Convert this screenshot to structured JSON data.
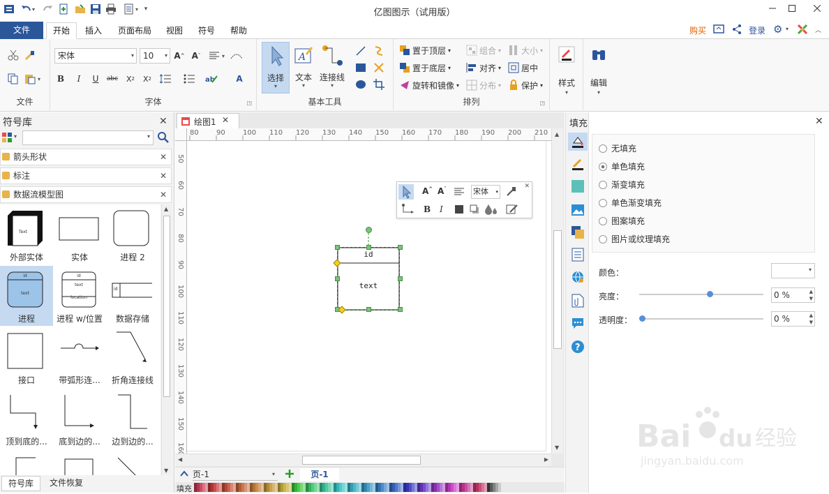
{
  "app": {
    "title": "亿图图示（试用版）"
  },
  "ribbon": {
    "file_tab": "文件",
    "tabs": [
      "开始",
      "插入",
      "页面布局",
      "视图",
      "符号",
      "帮助"
    ],
    "right": {
      "buy": "购买",
      "login": "登录"
    },
    "groups": {
      "file": "文件",
      "font": "字体",
      "basic_tools": "基本工具",
      "arrange": "排列",
      "style": "样式",
      "edit": "编辑"
    },
    "font": {
      "family": "宋体",
      "size": "10"
    },
    "tools": {
      "select": "选择",
      "text": "文本",
      "connector": "连接线"
    },
    "arrange": {
      "bring_front": "置于顶层",
      "send_back": "置于底层",
      "rotate_mirror": "旋转和镜像",
      "group": "组合",
      "align": "对齐",
      "distribute": "分布",
      "size": "大小",
      "center": "居中",
      "protect": "保护"
    }
  },
  "library": {
    "title": "符号库",
    "search_placeholder": "",
    "categories": [
      "箭头形状",
      "标注",
      "数据流模型图"
    ],
    "symbols": [
      "外部实体",
      "实体",
      "进程 2",
      "进程",
      "进程 w/位置",
      "数据存储",
      "接口",
      "带弧形连...",
      "折角连接线",
      "顶到底的...",
      "底到边的...",
      "边到边的..."
    ],
    "symbol_texts": {
      "ext_text": "Text",
      "id": "id",
      "text": "text",
      "location": "location"
    },
    "bottom_tabs": [
      "符号库",
      "文件恢复"
    ]
  },
  "document": {
    "tab": "绘图1",
    "page_select": "页-1",
    "page_tab": "页-1",
    "fill_label": "填充"
  },
  "ruler": {
    "h": [
      "80",
      "90",
      "100",
      "110",
      "120",
      "130",
      "140",
      "150",
      "160",
      "170",
      "180",
      "190",
      "200",
      "210"
    ],
    "v": [
      "50",
      "60",
      "70",
      "80",
      "90",
      "100",
      "110",
      "120",
      "130",
      "140",
      "150",
      "160"
    ]
  },
  "shape": {
    "id_text": "id",
    "body_text": "text"
  },
  "mini_toolbar": {
    "font": "宋体"
  },
  "fill_panel": {
    "title": "填充",
    "options": [
      "无填充",
      "单色填充",
      "渐变填充",
      "单色渐变填充",
      "图案填充",
      "图片或纹理填充"
    ],
    "selected": 1,
    "color_label": "颜色：",
    "brightness_label": "亮度：",
    "brightness_value": "0 %",
    "brightness_level": 0.57,
    "transparency_label": "透明度：",
    "transparency_value": "0 %",
    "transparency_level": 0.0
  },
  "colors": {
    "accent": "#2b579a",
    "ribbon_bg": "#f8f8f8",
    "selected_bg": "#c5d9f1"
  },
  "watermark": {
    "text": "Bai 经验",
    "url": "jingyan.baidu.com"
  }
}
